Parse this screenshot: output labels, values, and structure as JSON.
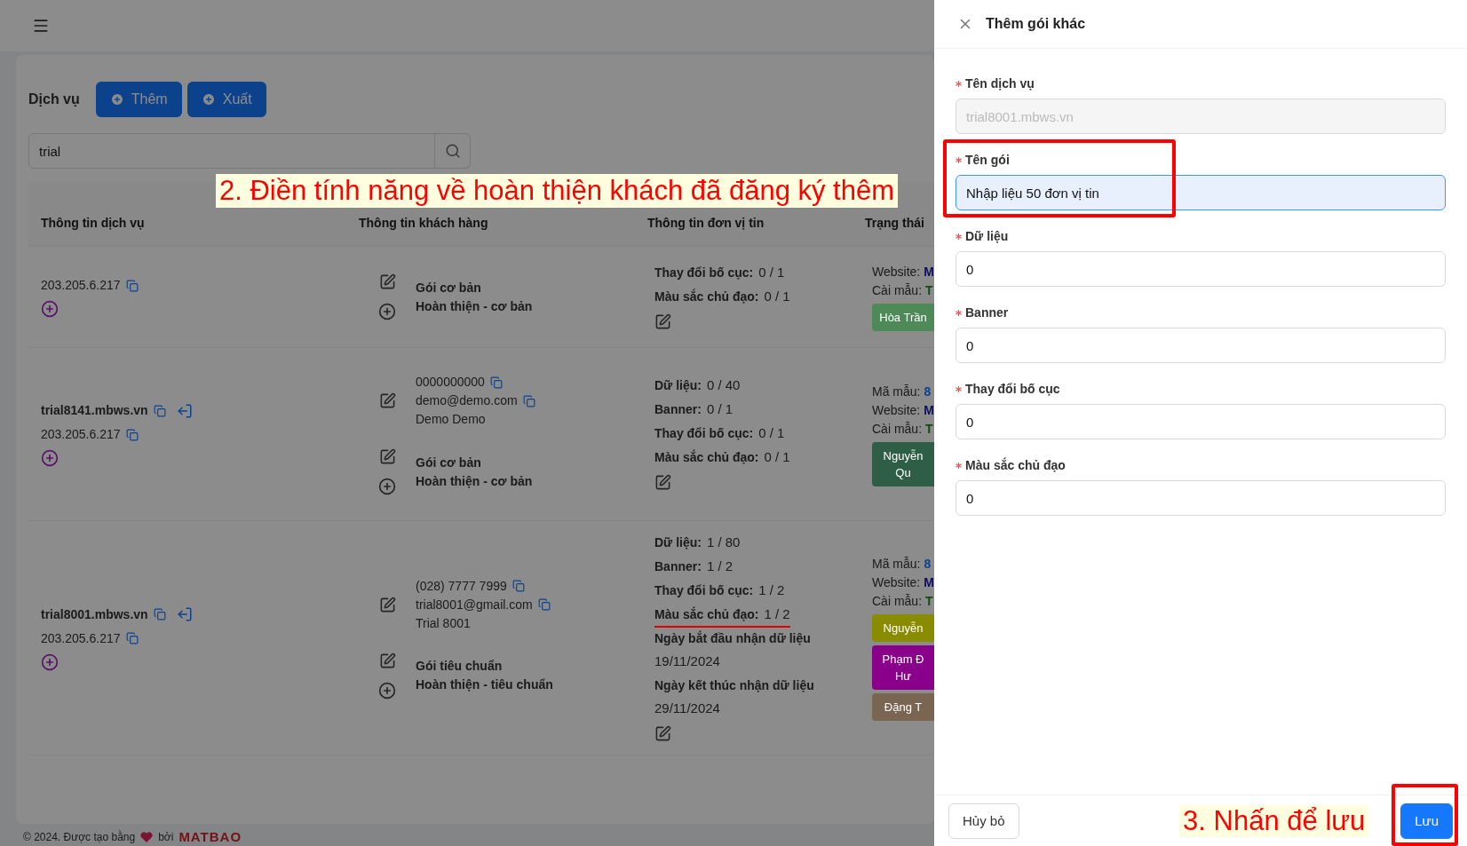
{
  "page": {
    "title": "Dịch vụ",
    "actions": [
      "Thêm",
      "Xuất"
    ],
    "search": {
      "value": "trial"
    }
  },
  "table": {
    "columns": [
      "Thông tin dịch vụ",
      "Thông tin khách hàng",
      "Thông tin đơn vị tin",
      "Trạng thái"
    ],
    "rows": [
      {
        "domain": null,
        "ip": "203.205.6.217",
        "contact": null,
        "package": "Gói cơ bản",
        "package_detail": "Hoàn thiện - cơ bản",
        "units": [
          {
            "kind": "count",
            "label": "Thay đổi bố cục:",
            "value": "0 / 1",
            "underlined": false
          },
          {
            "kind": "count",
            "label": "Màu sắc chủ đạo:",
            "value": "0 / 1",
            "underlined": false
          }
        ],
        "status": {
          "lines": [
            {
              "label": "Website:",
              "value": "M"
            },
            {
              "label": "Cài mẫu:",
              "value": "T"
            }
          ],
          "tags": [
            {
              "text": "Hòa Trần",
              "color": "#4e8a57"
            }
          ]
        }
      },
      {
        "domain": "trial8141.mbws.vn",
        "ip": "203.205.6.217",
        "contact": {
          "phone": "0000000000",
          "email": "demo@demo.com",
          "name": "Demo Demo"
        },
        "package": "Gói cơ bản",
        "package_detail": "Hoàn thiện - cơ bản",
        "units": [
          {
            "kind": "count",
            "label": "Dữ liệu:",
            "value": "0 / 40",
            "underlined": false
          },
          {
            "kind": "count",
            "label": "Banner:",
            "value": "0 / 1",
            "underlined": false
          },
          {
            "kind": "count",
            "label": "Thay đổi bố cục:",
            "value": "0 / 1",
            "underlined": false
          },
          {
            "kind": "count",
            "label": "Màu sắc chủ đạo:",
            "value": "0 / 1",
            "underlined": false
          }
        ],
        "status": {
          "lines": [
            {
              "label": "Mã mẫu:",
              "value": "8"
            },
            {
              "label": "Website:",
              "value": "M"
            },
            {
              "label": "Cài mẫu:",
              "value": "T"
            }
          ],
          "tags": [
            {
              "text": "Nguyễn Qu",
              "color": "#2f5e46"
            }
          ]
        }
      },
      {
        "domain": "trial8001.mbws.vn",
        "ip": "203.205.6.217",
        "contact": {
          "phone": "(028) 7777 7999",
          "email": "trial8001@gmail.com",
          "name": "Trial 8001"
        },
        "package": "Gói tiêu chuẩn",
        "package_detail": "Hoàn thiện - tiêu chuẩn",
        "units": [
          {
            "kind": "count",
            "label": "Dữ liệu:",
            "value": "1 / 80",
            "underlined": false
          },
          {
            "kind": "count",
            "label": "Banner:",
            "value": "1 / 2",
            "underlined": false
          },
          {
            "kind": "count",
            "label": "Thay đổi bố cục:",
            "value": "1 / 2",
            "underlined": false
          },
          {
            "kind": "count",
            "label": "Màu sắc chủ đạo:",
            "value": "1 / 2",
            "underlined": true
          },
          {
            "kind": "date",
            "label": "Ngày bắt đầu nhận dữ liệu",
            "value": "19/11/2024",
            "underlined": false
          },
          {
            "kind": "date",
            "label": "Ngày kết thúc nhận dữ liệu",
            "value": "29/11/2024",
            "underlined": false
          }
        ],
        "status": {
          "lines": [
            {
              "label": "Mã mẫu:",
              "value": "8"
            },
            {
              "label": "Website:",
              "value": "M"
            },
            {
              "label": "Cài mẫu:",
              "value": "T"
            }
          ],
          "tags": [
            {
              "text": "Nguyễn",
              "color": "#8a8c00"
            },
            {
              "text": "Phạm Đ Hư",
              "color": "#8a008a"
            },
            {
              "text": "Đặng T",
              "color": "#7a6452"
            }
          ]
        }
      }
    ]
  },
  "footer": {
    "text": "© 2024. Được tạo bằng",
    "by": "bởi",
    "logo": "MATBAO"
  },
  "callout": {
    "text": "2. Điền tính năng về hoàn thiện khách đã đăng ký thêm"
  },
  "drawer": {
    "title": "Thêm gói khác",
    "fields": [
      {
        "label": "Tên dịch vụ",
        "value": "trial8001.mbws.vn",
        "required": true,
        "disabled": true,
        "focused": false,
        "highlighted": false
      },
      {
        "label": "Tên gói",
        "value": "Nhập liệu 50 đơn vị tin",
        "required": true,
        "disabled": false,
        "focused": true,
        "highlighted": true
      },
      {
        "label": "Dữ liệu",
        "value": "0",
        "required": true,
        "disabled": false,
        "focused": false,
        "highlighted": false
      },
      {
        "label": "Banner",
        "value": "0",
        "required": true,
        "disabled": false,
        "focused": false,
        "highlighted": false
      },
      {
        "label": "Thay đổi bố cục",
        "value": "0",
        "required": true,
        "disabled": false,
        "focused": false,
        "highlighted": false
      },
      {
        "label": "Màu sắc chủ đạo",
        "value": "0",
        "required": true,
        "disabled": false,
        "focused": false,
        "highlighted": false
      }
    ],
    "callout": {
      "text": "3. Nhấn để lưu"
    },
    "buttons": [
      {
        "label": "Hủy bỏ",
        "kind": "default",
        "highlighted": false
      },
      {
        "label": "Lưu",
        "kind": "primary",
        "highlighted": true
      }
    ]
  }
}
